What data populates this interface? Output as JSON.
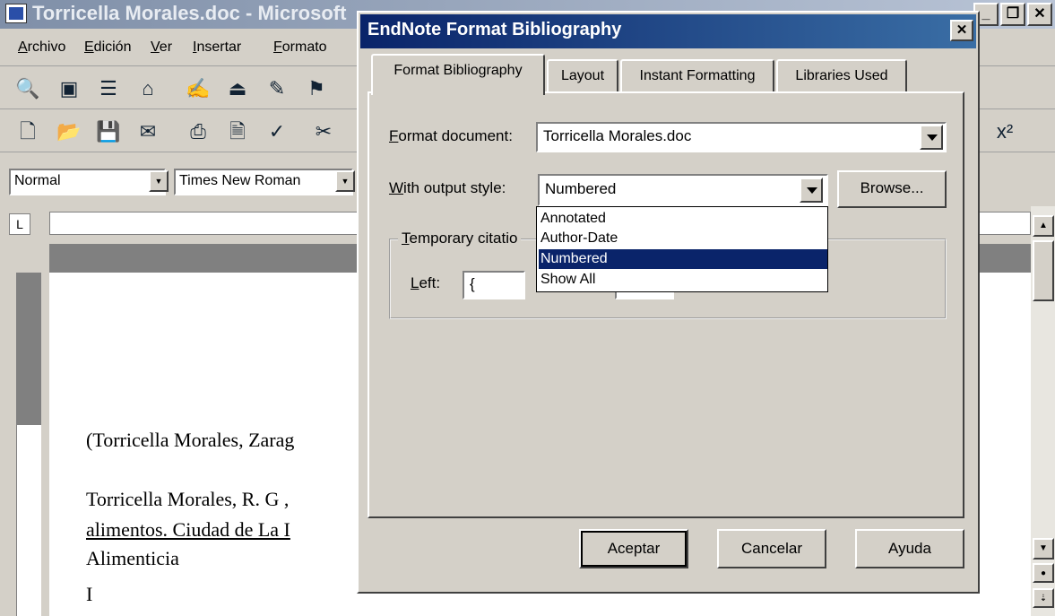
{
  "word": {
    "title": "Torricella Morales.doc - Microsoft",
    "menu": [
      "Archivo",
      "Edición",
      "Ver",
      "Insertar",
      "Formato"
    ],
    "style_box": "Normal",
    "font_box": "Times New Roman",
    "doc_lines": [
      "(Torricella Morales, Zarag",
      "Torricella Morales, R. G ,",
      "alimentos. Ciudad de La I",
      "Alimenticia"
    ],
    "cursor_char": "I"
  },
  "dialog": {
    "title": "EndNote Format Bibliography",
    "tabs": [
      "Format Bibliography",
      "Layout",
      "Instant Formatting",
      "Libraries Used"
    ],
    "format_document_label": "Format document:",
    "format_document_value": "Torricella Morales.doc",
    "output_style_label": "With output style:",
    "output_style_value": "Numbered",
    "browse_label": "Browse...",
    "temp_citation_label": "Temporary citatio",
    "left_label": "Left:",
    "left_value": "{",
    "style_options": [
      "Annotated",
      "Author-Date",
      "Numbered",
      "Show All"
    ],
    "selected_option": "Numbered",
    "ok_label": "Aceptar",
    "cancel_label": "Cancelar",
    "help_label": "Ayuda"
  }
}
